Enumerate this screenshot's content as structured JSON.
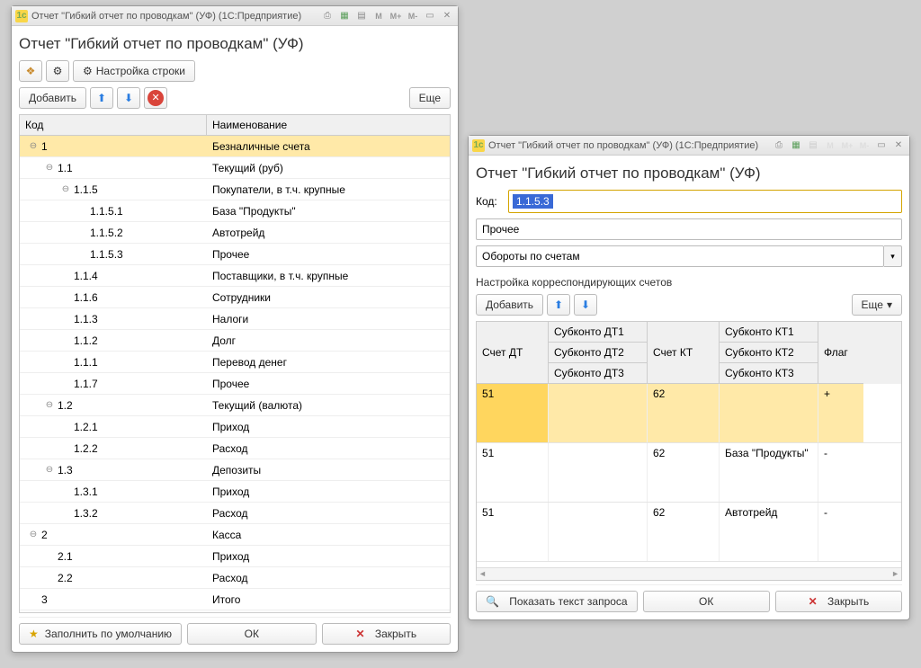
{
  "w1": {
    "title": "Отчет \"Гибкий отчет по проводкам\" (УФ)  (1С:Предприятие)",
    "page_title": "Отчет \"Гибкий отчет по проводкам\" (УФ)",
    "settings_btn": "Настройка строки",
    "add_btn": "Добавить",
    "more_btn": "Еще",
    "col_code": "Код",
    "col_name": "Наименование",
    "rows": [
      {
        "code": "1",
        "name": "Безналичные счета",
        "indent": 0,
        "toggle": "⊖",
        "selected": true
      },
      {
        "code": "1.1",
        "name": "Текущий (руб)",
        "indent": 1,
        "toggle": "⊖"
      },
      {
        "code": "1.1.5",
        "name": "Покупатели, в т.ч. крупные",
        "indent": 2,
        "toggle": "⊖"
      },
      {
        "code": "1.1.5.1",
        "name": "База \"Продукты\"",
        "indent": 3,
        "toggle": ""
      },
      {
        "code": "1.1.5.2",
        "name": "Автотрейд",
        "indent": 3,
        "toggle": ""
      },
      {
        "code": "1.1.5.3",
        "name": "Прочее",
        "indent": 3,
        "toggle": ""
      },
      {
        "code": "1.1.4",
        "name": "Поставщики, в т.ч. крупные",
        "indent": 2,
        "toggle": ""
      },
      {
        "code": "1.1.6",
        "name": "Сотрудники",
        "indent": 2,
        "toggle": ""
      },
      {
        "code": "1.1.3",
        "name": "Налоги",
        "indent": 2,
        "toggle": ""
      },
      {
        "code": "1.1.2",
        "name": "Долг",
        "indent": 2,
        "toggle": ""
      },
      {
        "code": "1.1.1",
        "name": "Перевод денег",
        "indent": 2,
        "toggle": ""
      },
      {
        "code": "1.1.7",
        "name": "Прочее",
        "indent": 2,
        "toggle": ""
      },
      {
        "code": "1.2",
        "name": "Текущий (валюта)",
        "indent": 1,
        "toggle": "⊖"
      },
      {
        "code": "1.2.1",
        "name": "Приход",
        "indent": 2,
        "toggle": ""
      },
      {
        "code": "1.2.2",
        "name": "Расход",
        "indent": 2,
        "toggle": ""
      },
      {
        "code": "1.3",
        "name": "Депозиты",
        "indent": 1,
        "toggle": "⊖"
      },
      {
        "code": "1.3.1",
        "name": "Приход",
        "indent": 2,
        "toggle": ""
      },
      {
        "code": "1.3.2",
        "name": "Расход",
        "indent": 2,
        "toggle": ""
      },
      {
        "code": "2",
        "name": "Касса",
        "indent": 0,
        "toggle": "⊖"
      },
      {
        "code": "2.1",
        "name": "Приход",
        "indent": 1,
        "toggle": ""
      },
      {
        "code": "2.2",
        "name": "Расход",
        "indent": 1,
        "toggle": ""
      },
      {
        "code": "3",
        "name": "Итого",
        "indent": 0,
        "toggle": ""
      }
    ],
    "fill_default": "Заполнить по умолчанию",
    "ok": "ОК",
    "close": "Закрыть"
  },
  "w2": {
    "title": "Отчет \"Гибкий отчет по проводкам\" (УФ)  (1С:Предприятие)",
    "page_title": "Отчет \"Гибкий отчет по проводкам\" (УФ)",
    "code_label": "Код:",
    "code_value": "1.1.5.3",
    "name_value": "Прочее",
    "combo_value": "Обороты по счетам",
    "sub_header": "Настройка корреспондирующих счетов",
    "add_btn": "Добавить",
    "more_btn": "Еще",
    "headers": {
      "dt": "Счет ДТ",
      "sdt1": "Субконто ДТ1",
      "sdt2": "Субконто ДТ2",
      "sdt3": "Субконто ДТ3",
      "kt": "Счет КТ",
      "skt1": "Субконто КТ1",
      "skt2": "Субконто КТ2",
      "skt3": "Субконто КТ3",
      "flag": "Флаг"
    },
    "rows": [
      {
        "dt": "51",
        "sdt": "",
        "kt": "62",
        "skt": "",
        "flag": "+",
        "sel": true
      },
      {
        "dt": "51",
        "sdt": "",
        "kt": "62",
        "skt": "База \"Продукты\"",
        "flag": "-"
      },
      {
        "dt": "51",
        "sdt": "",
        "kt": "62",
        "skt": "Автотрейд",
        "flag": "-"
      }
    ],
    "show_query": "Показать текст запроса",
    "ok": "ОК",
    "close": "Закрыть"
  }
}
